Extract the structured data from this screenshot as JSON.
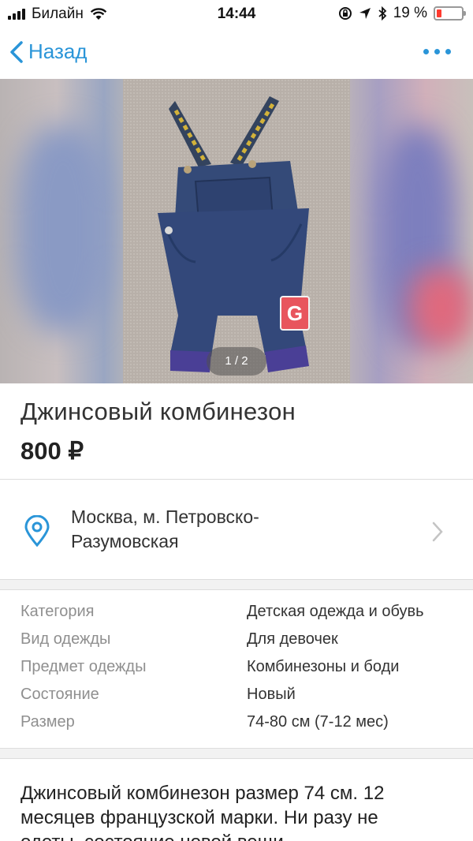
{
  "status_bar": {
    "carrier": "Билайн",
    "time": "14:44",
    "battery": "19 %",
    "battery_level": 0.19,
    "icons": [
      "signal-icon",
      "wifi-icon",
      "orientation-lock-icon",
      "location-arrow-icon",
      "bluetooth-icon",
      "battery-icon"
    ]
  },
  "nav": {
    "back_label": "Назад",
    "more_icon": "ellipsis-icon"
  },
  "gallery": {
    "indicator": "1 / 2",
    "photo": "denim-overalls-photo"
  },
  "listing": {
    "title": "Джинсовый комбинезон",
    "price": "800 ₽",
    "location_line1": "Москва, м. Петровско-",
    "location_line2": "Разумовская"
  },
  "params": [
    {
      "label": "Категория",
      "value": "Детская одежда и обувь"
    },
    {
      "label": "Вид одежды",
      "value": "Для девочек"
    },
    {
      "label": "Предмет одежды",
      "value": "Комбинезоны и боди"
    },
    {
      "label": "Состояние",
      "value": "Новый"
    },
    {
      "label": "Размер",
      "value": "74-80 см (7-12 мес)"
    }
  ],
  "description": {
    "line1": "Джинсовый комбинезон размер 74 см. 12",
    "line2": "месяцев французской марки. Ни разу не",
    "line3": "одеты, состояние новой вещи."
  },
  "colors": {
    "accent": "#2a95d8",
    "battery_low": "#ff3b30",
    "denim": "#2f4066"
  }
}
